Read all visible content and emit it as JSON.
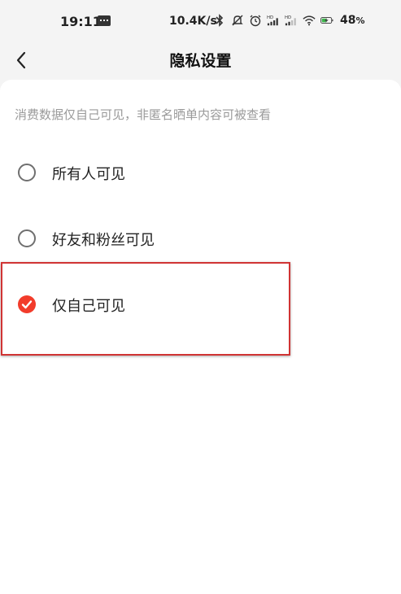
{
  "status_bar": {
    "time": "19:11",
    "net_speed": "10.4K/s",
    "battery_percent": "48",
    "battery_unit": "%",
    "icons": [
      "message-icon",
      "bluetooth-icon",
      "mute-icon",
      "alarm-icon",
      "hd-signal-icon",
      "hd-signal-icon",
      "wifi-icon",
      "battery-charging-icon"
    ]
  },
  "header": {
    "title": "隐私设置",
    "back_icon": "chevron-left-icon"
  },
  "hint": "消费数据仅自己可见，非匿名晒单内容可被查看",
  "options": [
    {
      "label": "所有人可见",
      "selected": false
    },
    {
      "label": "好友和粉丝可见",
      "selected": false
    },
    {
      "label": "仅自己可见",
      "selected": true
    }
  ],
  "colors": {
    "accent": "#f23c2b",
    "highlight_border": "#d03434",
    "hint_text": "#9a9a9a",
    "header_bg": "#f4f4f4"
  }
}
